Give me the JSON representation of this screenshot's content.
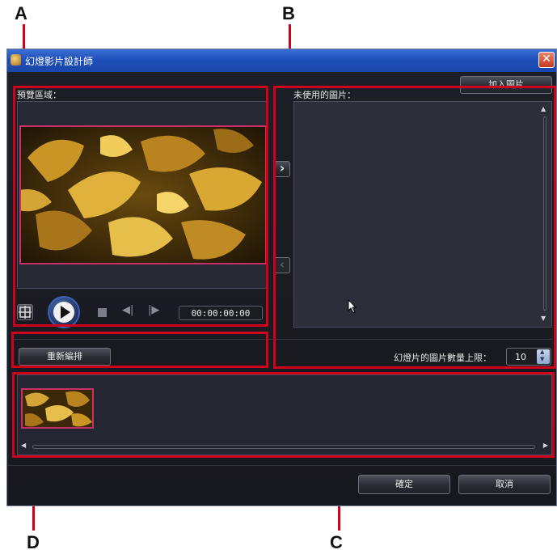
{
  "callouts": {
    "a": "A",
    "b": "B",
    "c": "C",
    "d": "D"
  },
  "window": {
    "title": "幻燈影片設計師",
    "close_glyph": "✕"
  },
  "preview": {
    "label": "預覽區域：",
    "timecode": "00:00:00:00"
  },
  "unused": {
    "label": "未使用的圖片：",
    "add_button": "加入圖片"
  },
  "arrows": {
    "right": "›",
    "left": "‹"
  },
  "reorder_button": "重新編排",
  "limit": {
    "label": "幻燈片的圖片數量上限：",
    "value": "10"
  },
  "footer": {
    "ok": "確定",
    "cancel": "取消"
  },
  "colors": {
    "callout_red": "#d0021b",
    "thumb_border": "#c8306a",
    "titlebar_blue": "#2458c4"
  },
  "icons": [
    "app-icon",
    "close-icon",
    "crop-icon",
    "play-icon",
    "stop-icon",
    "previous-frame-icon",
    "next-frame-icon",
    "chevron-right-icon",
    "chevron-left-icon",
    "scroll-up-icon",
    "scroll-down-icon",
    "scroll-left-icon",
    "scroll-right-icon",
    "spinner-up-icon",
    "spinner-down-icon",
    "mouse-cursor-icon"
  ]
}
